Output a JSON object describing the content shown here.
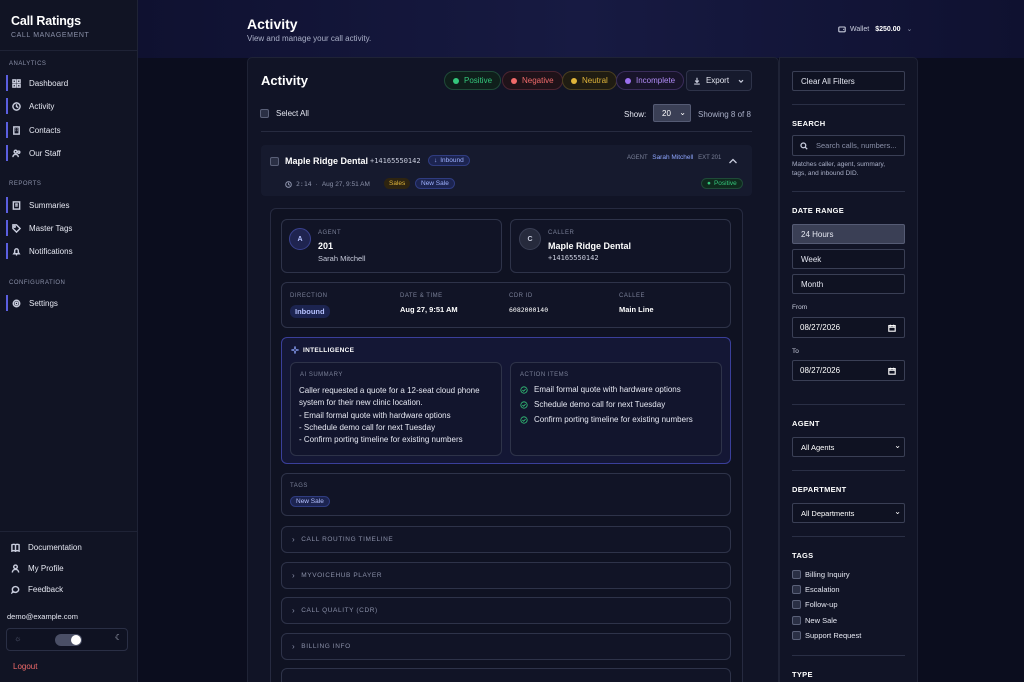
{
  "app": {
    "name": "Call Ratings",
    "subtitle": "CALL MANAGEMENT"
  },
  "sidebar": {
    "analytics_heading": "ANALYTICS",
    "analytics": [
      {
        "label": "Dashboard",
        "icon": "grid-icon"
      },
      {
        "label": "Activity",
        "icon": "clock-icon"
      },
      {
        "label": "Contacts",
        "icon": "building-icon"
      },
      {
        "label": "Our Staff",
        "icon": "people-icon"
      }
    ],
    "reports_heading": "REPORTS",
    "reports": [
      {
        "label": "Summaries",
        "icon": "summary-icon"
      },
      {
        "label": "Master Tags",
        "icon": "tag-icon"
      },
      {
        "label": "Notifications",
        "icon": "bell-icon"
      }
    ],
    "config_heading": "CONFIGURATION",
    "config": [
      {
        "label": "Settings",
        "icon": "gear-icon"
      }
    ],
    "bottom": [
      {
        "label": "Documentation",
        "icon": "book-icon"
      },
      {
        "label": "My Profile",
        "icon": "user-icon"
      },
      {
        "label": "Feedback",
        "icon": "chat-icon"
      }
    ],
    "user_email": "demo@example.com",
    "logout": "Logout"
  },
  "header": {
    "title": "Activity",
    "subtitle": "View and manage your call activity.",
    "wallet_label": "Wallet",
    "wallet_amount": "$250.00"
  },
  "main": {
    "title": "Activity",
    "filters": [
      {
        "label": "Positive",
        "color": "#34c77b"
      },
      {
        "label": "Negative",
        "color": "#f06a6a"
      },
      {
        "label": "Neutral",
        "color": "#e0b53a"
      },
      {
        "label": "Incomplete",
        "color": "#9b6ff0"
      }
    ],
    "export_label": "Export",
    "select_all": "Select All",
    "show_label": "Show:",
    "show_value": "20",
    "showing": "Showing 8 of 8"
  },
  "call": {
    "name": "Maple Ridge Dental",
    "number": "+14165550142",
    "direction_badge": "Inbound",
    "duration": "2:14",
    "datetime": "Aug 27, 9:51 AM",
    "tags": [
      "Sales",
      "New Sale"
    ],
    "agent_label": "AGENT",
    "agent_name": "Sarah Mitchell",
    "agent_ext": "EXT 201",
    "sentiment": "Positive",
    "details": {
      "agent_section_label": "AGENT",
      "agent_initial": "A",
      "agent_ext": "201",
      "agent_name": "Sarah Mitchell",
      "caller_section_label": "CALLER",
      "caller_initial": "C",
      "caller_name": "Maple Ridge Dental",
      "caller_number": "+14165550142",
      "direction_label": "DIRECTION",
      "direction_value": "Inbound",
      "datetime_label": "DATE & TIME",
      "datetime_value": "Aug 27, 9:51 AM",
      "cdr_label": "CDR ID",
      "cdr_value": "6082000140",
      "callee_label": "CALLEE",
      "callee_value": "Main Line"
    },
    "intelligence": {
      "title": "INTELLIGENCE",
      "summary_label": "AI SUMMARY",
      "summary_lines": [
        "Caller requested a quote for a 12-seat cloud phone",
        "system for their new clinic location.",
        "- Email formal quote with hardware options",
        "- Schedule demo call for next Tuesday",
        "- Confirm porting timeline for existing numbers"
      ],
      "actions_label": "ACTION ITEMS",
      "actions": [
        "Email formal quote with hardware options",
        "Schedule demo call for next Tuesday",
        "Confirm porting timeline for existing numbers"
      ]
    },
    "tags_section": {
      "label": "TAGS",
      "tag": "New Sale"
    },
    "sections": [
      "CALL ROUTING TIMELINE",
      "MYVOICEHUB PLAYER",
      "CALL QUALITY (CDR)",
      "BILLING INFO"
    ]
  },
  "filters_panel": {
    "clear": "Clear All Filters",
    "search_heading": "SEARCH",
    "search_placeholder": "Search calls, numbers...",
    "search_hint": [
      "Matches caller, agent, summary,",
      "tags, and inbound DID."
    ],
    "date_heading": "DATE RANGE",
    "ranges": [
      "24 Hours",
      "Week",
      "Month"
    ],
    "active_range": "24 Hours",
    "from_label": "From",
    "from_value": "08/27/2026",
    "to_label": "To",
    "to_value": "08/27/2026",
    "agent_heading": "AGENT",
    "agent_value": "All Agents",
    "dept_heading": "DEPARTMENT",
    "dept_value": "All Departments",
    "tags_heading": "TAGS",
    "tags": [
      "Billing Inquiry",
      "Escalation",
      "Follow-up",
      "New Sale",
      "Support Request"
    ],
    "type_heading": "TYPE"
  }
}
